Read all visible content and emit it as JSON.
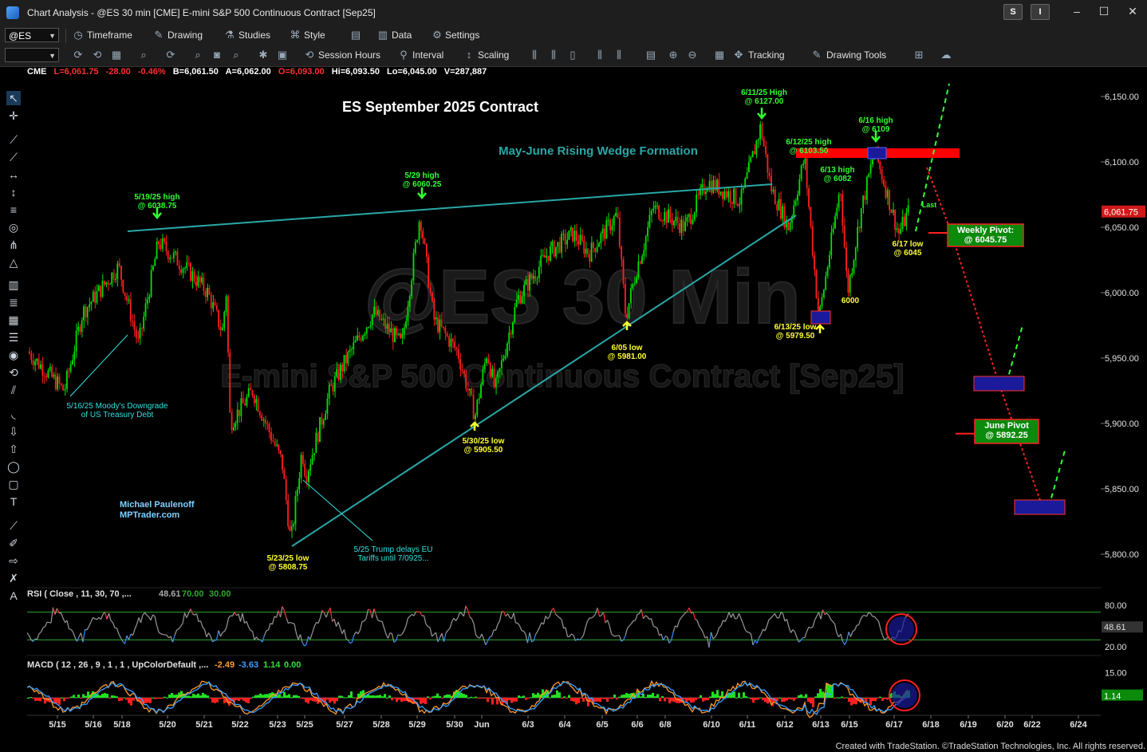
{
  "window": {
    "title": "Chart Analysis - @ES 30 min [CME] E-mini S&P 500 Continuous Contract [Sep25]",
    "badge_s": "S",
    "badge_i": "I"
  },
  "toolbar1": {
    "symbol": "@ES",
    "timeframe": "Timeframe",
    "drawing": "Drawing",
    "studies": "Studies",
    "style": "Style",
    "data": "Data",
    "settings": "Settings"
  },
  "toolbar2": {
    "session_hours": "Session Hours",
    "interval": "Interval",
    "scaling": "Scaling",
    "tracking": "Tracking",
    "drawing_tools": "Drawing Tools"
  },
  "infobar": {
    "exchange": "CME",
    "last": "L=6,061.75",
    "change": "-28.00",
    "pct": "-0.46%",
    "bid": "B=6,061.50",
    "ask": "A=6,062.00",
    "open": "O=6,093.00",
    "high": "Hi=6,093.50",
    "low": "Lo=6,045.00",
    "volume": "V=287,887"
  },
  "colors": {
    "up_candle": "#00e000",
    "down_candle": "#ff2020",
    "trendline": "#2aa7a7",
    "annotation_green": "#33ff33",
    "annotation_yellow": "#ffff33",
    "annotation_cyan": "#33e0e0",
    "red_zone": "#ff0000",
    "blue_box": "#1a1a9a",
    "pivot_green": "#0b8a0b"
  },
  "watermark": {
    "symbol": "@ES 30 Min",
    "name": "E-mini S&P 500 Continuous Contract [Sep25]"
  },
  "chart_data": {
    "type": "candlestick",
    "title": "ES September 2025 Contract",
    "subtitle": "May-June Rising Wedge Formation",
    "y_axis": {
      "range": [
        5775,
        6165
      ],
      "ticks": [
        "6,150.00",
        "6,100.00",
        "6,050.00",
        "6,000.00",
        "5,950.00",
        "5,900.00",
        "5,850.00",
        "5,800.00"
      ],
      "last_price_label": "6,061.75"
    },
    "x_axis": {
      "ticks": [
        "5/15",
        "5/16",
        "5/18",
        "5/20",
        "5/21",
        "5/22",
        "5/23",
        "5/25",
        "5/27",
        "5/28",
        "5/29",
        "5/30",
        "Jun",
        "6/3",
        "6/4",
        "6/5",
        "6/6",
        "6/8",
        "6/10",
        "6/11",
        "6/12",
        "6/13",
        "6/15",
        "6/17",
        "6/18",
        "6/19",
        "6/20",
        "6/22",
        "6/24"
      ]
    },
    "price_path": [
      {
        "x": "5/15",
        "close": 5955
      },
      {
        "x": "5/16",
        "close": 5925
      },
      {
        "x": "5/16",
        "close": 5985
      },
      {
        "x": "5/18",
        "close": 6020
      },
      {
        "x": "5/18",
        "close": 5960
      },
      {
        "x": "5/19",
        "close": 6038.75
      },
      {
        "x": "5/20",
        "close": 6015
      },
      {
        "x": "5/20",
        "close": 6000
      },
      {
        "x": "5/21",
        "close": 5970
      },
      {
        "x": "5/21",
        "close": 6000
      },
      {
        "x": "5/22",
        "close": 5900
      },
      {
        "x": "5/22",
        "close": 5925
      },
      {
        "x": "5/23",
        "close": 5870
      },
      {
        "x": "5/23",
        "close": 5808.75
      },
      {
        "x": "5/25",
        "close": 5880
      },
      {
        "x": "5/25",
        "close": 5860
      },
      {
        "x": "5/27",
        "close": 5925
      },
      {
        "x": "5/27",
        "close": 5945
      },
      {
        "x": "5/28",
        "close": 5985
      },
      {
        "x": "5/28",
        "close": 5960
      },
      {
        "x": "5/29",
        "close": 6060.25
      },
      {
        "x": "5/29",
        "close": 5980
      },
      {
        "x": "5/30",
        "close": 5955
      },
      {
        "x": "5/30",
        "close": 5905.5
      },
      {
        "x": "Jun",
        "close": 5955
      },
      {
        "x": "Jun",
        "close": 5925
      },
      {
        "x": "6/3",
        "close": 5995
      },
      {
        "x": "6/3",
        "close": 6030
      },
      {
        "x": "6/4",
        "close": 6045
      },
      {
        "x": "6/4",
        "close": 6030
      },
      {
        "x": "6/5",
        "close": 6060
      },
      {
        "x": "6/5",
        "close": 5981
      },
      {
        "x": "6/6",
        "close": 6020
      },
      {
        "x": "6/6",
        "close": 6035
      },
      {
        "x": "6/8",
        "close": 6065
      },
      {
        "x": "6/8",
        "close": 6050
      },
      {
        "x": "6/10",
        "close": 6085
      },
      {
        "x": "6/10",
        "close": 6070
      },
      {
        "x": "6/11",
        "close": 6127
      },
      {
        "x": "6/11",
        "close": 6080
      },
      {
        "x": "6/12",
        "close": 6050
      },
      {
        "x": "6/12",
        "close": 6103.5
      },
      {
        "x": "6/13",
        "close": 5979.5
      },
      {
        "x": "6/13",
        "close": 6082
      },
      {
        "x": "6/15",
        "close": 6000
      },
      {
        "x": "6/15",
        "close": 6060
      },
      {
        "x": "6/16",
        "close": 6109
      },
      {
        "x": "6/17",
        "close": 6045
      },
      {
        "x": "6/17",
        "close": 6061.75
      }
    ],
    "annotations": [
      {
        "text": "5/19/25 high",
        "value": "@ 6038.75"
      },
      {
        "text": "5/29 high",
        "value": "@ 6060.25"
      },
      {
        "text": "6/11/25 High",
        "value": "@ 6127.00"
      },
      {
        "text": "6/12/25 high",
        "value": "@ 6103.50"
      },
      {
        "text": "6/16 high",
        "value": "@ 6109"
      },
      {
        "text": "6/13 high",
        "value": "@ 6082"
      },
      {
        "text": "6/17 low",
        "value": "@ 6045"
      },
      {
        "text": "6/13/25 low",
        "value": "@ 5979.50"
      },
      {
        "text": "6/05 low",
        "value": "@ 5981.00"
      },
      {
        "text": "5/30/25 low",
        "value": "@ 5905.50"
      },
      {
        "text": "5/23/25 low",
        "value": "@ 5808.75"
      },
      {
        "text": "6000",
        "value": ""
      },
      {
        "text": "Last",
        "value": ""
      }
    ],
    "notes": [
      {
        "line1": "5/16/25 Moody's Downgrade",
        "line2": "of US Treasury Debt"
      },
      {
        "line1": "5/25 Trump delays EU",
        "line2": "Tariffs until 7/0925..."
      }
    ],
    "pivots": [
      {
        "label": "Weekly Pivot:",
        "value": "@ 6045.75"
      },
      {
        "label": "June Pivot",
        "value": "@ 5892.25"
      }
    ],
    "author": {
      "name": "Michael Paulenoff",
      "site": "MPTrader.com"
    }
  },
  "rsi": {
    "label": "RSI ( Close , 11, 30, 70 ,...",
    "value": "48.61",
    "upper": "70.00",
    "lower": "30.00",
    "ticks": [
      "80.00",
      "20.00"
    ],
    "last": "48.61"
  },
  "macd": {
    "label": "MACD ( 12 , 26 , 9 , 1 , 1 , UpColorDefault ,...",
    "macd": "-2.49",
    "signal": "-3.63",
    "hist": "1.14",
    "zero": "0.00",
    "ticks": [
      "15.00"
    ],
    "last": "1.14"
  },
  "footer": "Created with TradeStation. ©TradeStation Technologies, Inc. All rights reserved."
}
